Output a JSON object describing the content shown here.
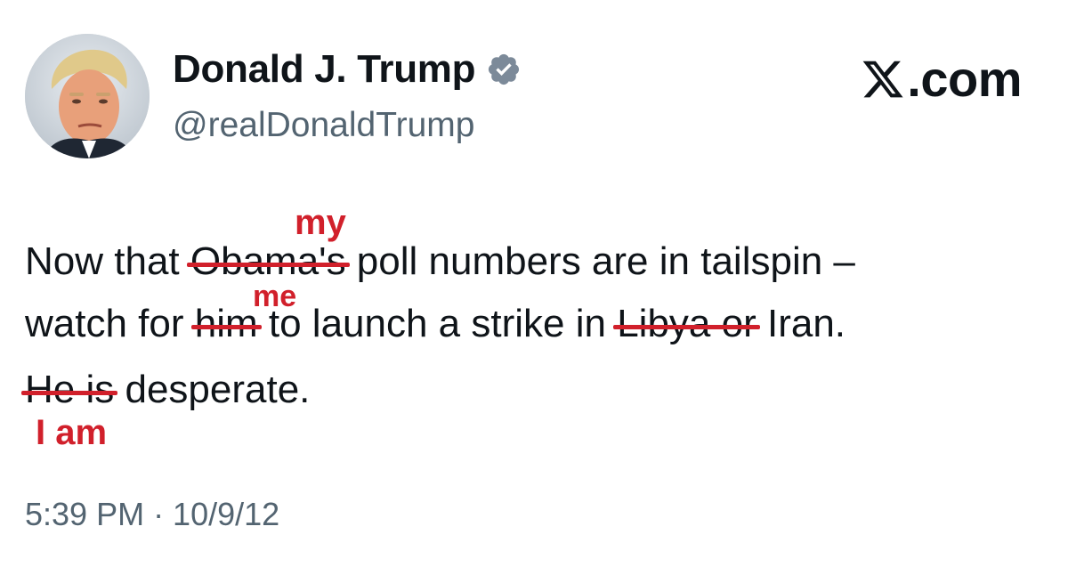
{
  "author": {
    "display_name": "Donald J. Trump",
    "handle": "@realDonaldTrump",
    "verified": true,
    "avatar_icon": "profile-photo"
  },
  "brand": {
    "label": ".com",
    "icon": "x-logo-icon"
  },
  "tweet": {
    "line1": {
      "before": "Now that ",
      "struck": "Obama's",
      "after": " poll numbers are in tailspin –"
    },
    "line2": {
      "before": "watch for ",
      "struck1": "him",
      "middle": " to launch a strike in ",
      "struck2": "Libya or",
      "after": " Iran."
    },
    "line3": {
      "struck": "He is",
      "after": " desperate."
    }
  },
  "corrections": {
    "obama": "my",
    "him": "me",
    "he_is": "I am"
  },
  "timestamp": "5:39 PM · 10/9/12",
  "colors": {
    "text": "#0f1419",
    "secondary": "#536471",
    "verified_badge": "#7c8a99",
    "annotation_red": "#d1202b"
  }
}
